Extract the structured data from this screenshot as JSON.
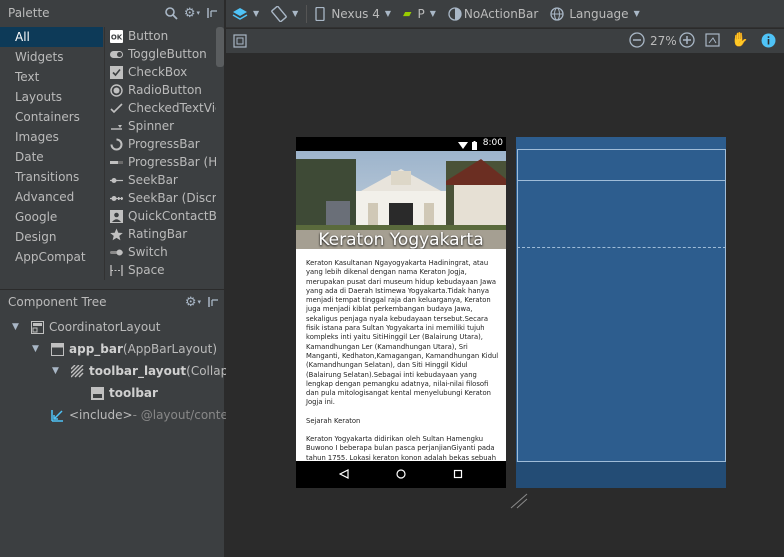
{
  "palette": {
    "title": "Palette",
    "categories": [
      "All",
      "Widgets",
      "Text",
      "Layouts",
      "Containers",
      "Images",
      "Date",
      "Transitions",
      "Advanced",
      "Google",
      "Design",
      "AppCompat"
    ],
    "selected_category": "All",
    "items": [
      {
        "label": "Button",
        "icon": "button-icon"
      },
      {
        "label": "ToggleButton",
        "icon": "toggle-button-icon"
      },
      {
        "label": "CheckBox",
        "icon": "checkbox-icon"
      },
      {
        "label": "RadioButton",
        "icon": "radio-button-icon"
      },
      {
        "label": "CheckedTextVie",
        "icon": "checked-text-view-icon"
      },
      {
        "label": "Spinner",
        "icon": "spinner-icon"
      },
      {
        "label": "ProgressBar",
        "icon": "progress-bar-icon"
      },
      {
        "label": "ProgressBar (Ho",
        "icon": "progress-bar-horizontal-icon"
      },
      {
        "label": "SeekBar",
        "icon": "seekbar-icon"
      },
      {
        "label": "SeekBar (Discret",
        "icon": "seekbar-discrete-icon"
      },
      {
        "label": "QuickContactBa",
        "icon": "quick-contact-badge-icon"
      },
      {
        "label": "RatingBar",
        "icon": "rating-bar-icon"
      },
      {
        "label": "Switch",
        "icon": "switch-icon"
      },
      {
        "label": "Space",
        "icon": "space-icon"
      }
    ]
  },
  "component_tree": {
    "title": "Component Tree",
    "nodes": [
      {
        "name": "CoordinatorLayout",
        "detail": ""
      },
      {
        "name": "app_bar",
        "detail": " (AppBarLayout)"
      },
      {
        "name": "toolbar_layout",
        "detail": " (Collapsin"
      },
      {
        "name": "toolbar",
        "detail": ""
      },
      {
        "name": "<include>",
        "detail": " - @layout/content"
      }
    ]
  },
  "toolbar": {
    "device": "Nexus 4",
    "api": "P",
    "theme": "NoActionBar",
    "language": "Language",
    "zoom": "27%"
  },
  "phone": {
    "time": "8:00",
    "title": "Keraton Yogyakarta",
    "paragraphs": [
      "Keraton Kasultanan Ngayogyakarta Hadiningrat, atau yang lebih dikenal dengan nama Keraton Jogja, merupakan pusat dari museum hidup kebudayaan Jawa yang ada di Daerah Istimewa Yogyakarta.Tidak hanya menjadi tempat tinggal raja dan keluarganya, Keraton juga menjadi kiblat perkembangan budaya Jawa, sekaligus penjaga nyala kebudayaan tersebut.Secara fisik istana para Sultan Yogyakarta ini memiliki tujuh kompleks inti yaitu SitiHinggil Ler (Balairung Utara), Kamandhungan Ler (Kamandhungan Utara), Sri Manganti, Kedhaton,Kamagangan, Kamandhungan Kidul (Kamandhungan Selatan), dan Siti Hinggil Kidul (Balairung Selatan).Sebagai inti kebudayaan yang lengkap dengan pemangku adatnya, nilai-nilai filosofi dan pula mitologisangat kental menyelubungi Keraton Jogja ini.",
      "Sejarah Keraton",
      "Keraton Yogyakarta didirikan oleh Sultan Hamengku Buwono I beberapa bulan pasca perjanjianGiyanti pada tahun 1755. Lokasi keraton konon adalah bekas sebuah pesanggarahan yang bernamaGarjitawati. Pesanggrahan"
    ]
  },
  "colors": {
    "panel_bg": "#3c3f41",
    "canvas_bg": "#2b2b2b",
    "selected_bg": "#0d3a58",
    "blueprint_bg": "#2d5d8e",
    "blueprint_line": "#9fbcd8",
    "icon_accent": "#4fc3f7",
    "api_icon": "#99cc00"
  }
}
